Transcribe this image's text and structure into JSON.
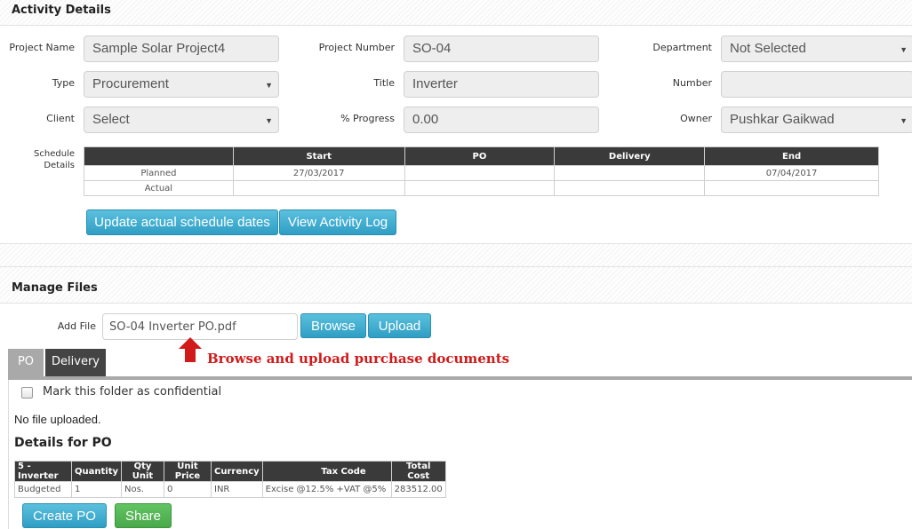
{
  "activity": {
    "section_title": "Activity Details",
    "project_name": {
      "label": "Project Name",
      "value": "Sample Solar Project4"
    },
    "project_number": {
      "label": "Project Number",
      "value": "SO-04"
    },
    "department": {
      "label": "Department",
      "value": "Not Selected"
    },
    "type": {
      "label": "Type",
      "value": "Procurement"
    },
    "title": {
      "label": "Title",
      "value": "Inverter"
    },
    "number": {
      "label": "Number",
      "value": ""
    },
    "client": {
      "label": "Client",
      "value": "Select"
    },
    "progress": {
      "label": "% Progress",
      "value": "0.00"
    },
    "owner": {
      "label": "Owner",
      "value": "Pushkar Gaikwad"
    },
    "schedule": {
      "label_line1": "Schedule",
      "label_line2": "Details",
      "headers": [
        "",
        "Start",
        "PO",
        "Delivery",
        "End"
      ],
      "rows": [
        [
          "Planned",
          "27/03/2017",
          "",
          "",
          "07/04/2017"
        ],
        [
          "Actual",
          "",
          "",
          "",
          ""
        ]
      ]
    },
    "update_button": "Update actual schedule dates",
    "log_button": "View Activity Log"
  },
  "files": {
    "section_title": "Manage Files",
    "add_file_label": "Add File",
    "file_value": "SO-04 Inverter PO.pdf",
    "browse_button": "Browse",
    "upload_button": "Upload",
    "annotation": "Browse and upload purchase documents",
    "tabs": [
      "PO",
      "Delivery"
    ],
    "confidential_label": "Mark this folder as confidential",
    "no_file_text": "No file uploaded.",
    "details_title": "Details for PO",
    "po_table": {
      "headers": [
        "5 - Inverter",
        "Quantity",
        "Qty Unit",
        "Unit Price",
        "Currency",
        "Tax Code",
        "Total Cost"
      ],
      "rows": [
        [
          "Budgeted",
          "1",
          "Nos.",
          "0",
          "INR",
          "Excise @12.5% +VAT @5%",
          "283512.00"
        ]
      ]
    },
    "create_po_button": "Create PO",
    "share_button": "Share"
  },
  "colors": {
    "accent_blue": "#2f9ec4",
    "accent_green": "#4aa84a",
    "annotation_red": "#d11a1a",
    "table_header": "#3a3a3a"
  }
}
